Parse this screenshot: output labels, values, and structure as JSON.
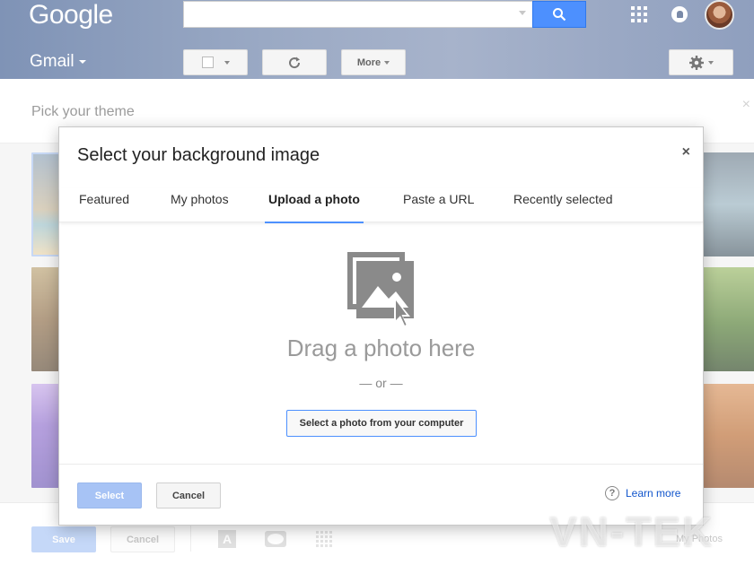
{
  "header": {
    "logo": "Google",
    "app_name": "Gmail",
    "more_label": "More"
  },
  "theme_picker": {
    "title": "Pick your theme",
    "close_glyph": "×",
    "save_label": "Save",
    "cancel_label": "Cancel",
    "text_icon_glyph": "A",
    "my_photos_label": "My Photos"
  },
  "dialog": {
    "title": "Select your background image",
    "close_glyph": "×",
    "tabs": [
      {
        "label": "Featured"
      },
      {
        "label": "My photos"
      },
      {
        "label": "Upload a photo"
      },
      {
        "label": "Paste a URL"
      },
      {
        "label": "Recently selected"
      }
    ],
    "drag_text": "Drag a photo here",
    "or_text": "— or —",
    "select_computer_label": "Select a photo from your computer",
    "select_label": "Select",
    "cancel_label": "Cancel",
    "learn_more_label": "Learn more",
    "help_glyph": "?"
  },
  "watermark": "VN-TEK",
  "colors": {
    "accent": "#4d90fe",
    "link": "#1155cc"
  }
}
